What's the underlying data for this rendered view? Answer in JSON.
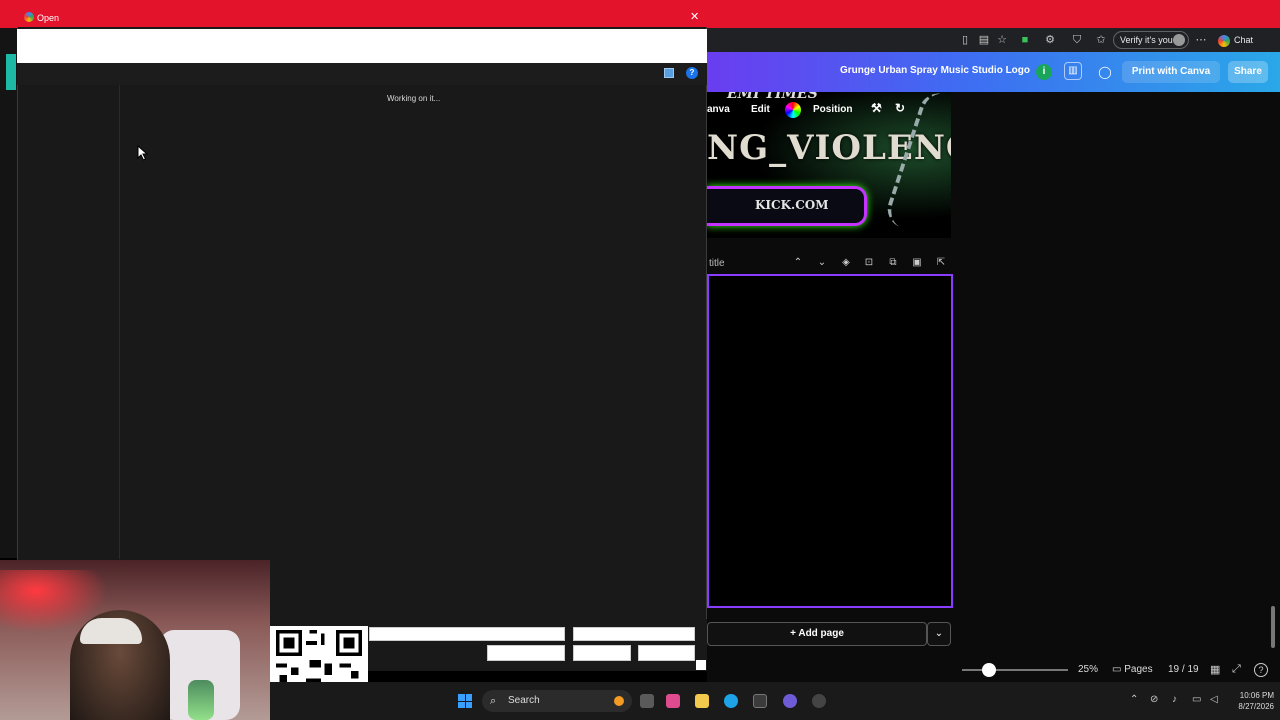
{
  "browser": {
    "verify_label": "Verify it's you",
    "chat_label": "Chat"
  },
  "canva": {
    "design_title": "Grunge Urban Spray Music Studio Logo",
    "print_label": "Print with Canva",
    "share_label": "Share",
    "context_toolbar": {
      "canva_label": "anva",
      "edit_label": "Edit",
      "position_label": "Position"
    },
    "artwork": {
      "top_text": "EMI TIMES",
      "title_text": "NG_VIOLENCE",
      "sub_text": "KICK.COM"
    },
    "page_title_label": "title",
    "add_page_label": "+ Add page",
    "footer": {
      "zoom_value": 0.25,
      "zoom_label": "25%",
      "pages_label": "Pages",
      "pages_count": "19 / 19"
    }
  },
  "dialog": {
    "title": "Open",
    "status_text": "Working on it..."
  },
  "taskbar": {
    "search_label": "Search",
    "time": "10:06 PM",
    "date": "8/27/2026"
  },
  "colors": {
    "accent_red": "#e2132a",
    "canva_purple": "#8b3dff",
    "canva_gradient_start": "#6a3df0",
    "canva_gradient_end": "#2aa8e8"
  }
}
